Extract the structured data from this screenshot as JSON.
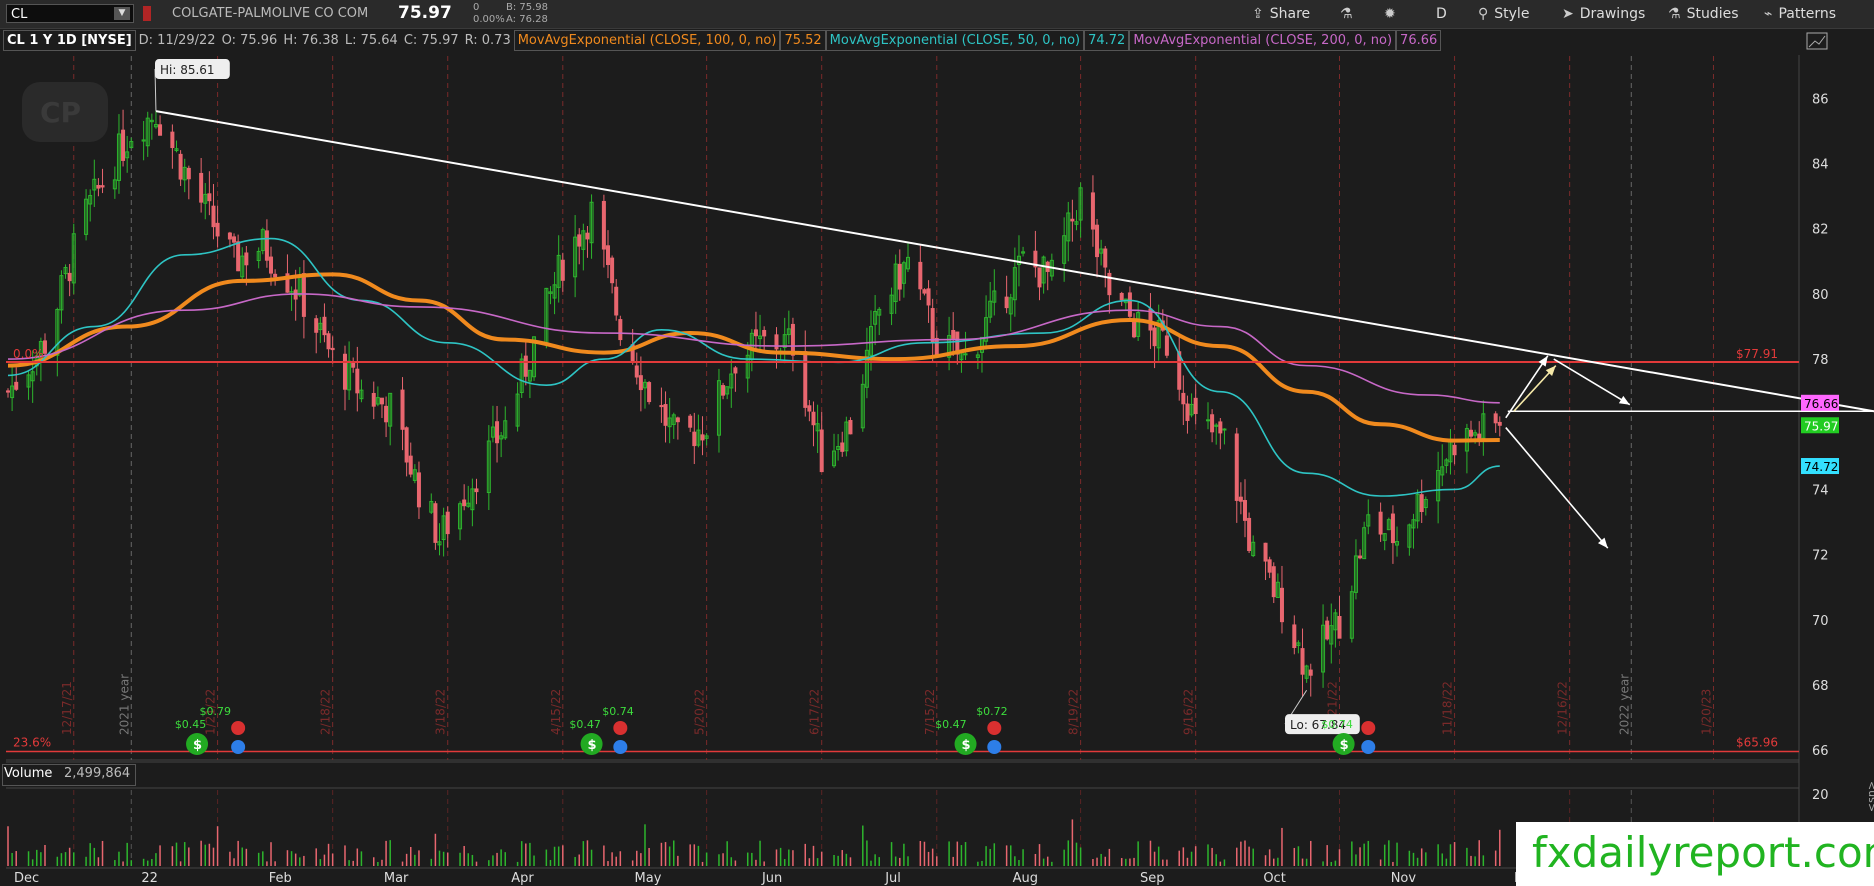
{
  "header": {
    "symbol": "CL",
    "company": "COLGATE-PALMOLIVE CO COM",
    "last": "75.97",
    "change": "0",
    "change_pct": "0.00%",
    "bid": "B: 75.98",
    "ask": "A: 76.28"
  },
  "toolbar": {
    "share": "Share",
    "period": "D",
    "style": "Style",
    "drawings": "Drawings",
    "studies": "Studies",
    "patterns": "Patterns"
  },
  "study_bar": {
    "title": "CL 1 Y 1D [NYSE]",
    "date": "D: 11/29/22",
    "open": "O: 75.96",
    "high": "H: 76.38",
    "low": "L: 75.64",
    "close": "C: 75.97",
    "range": "R: 0.73",
    "ema100_label": "MovAvgExponential (CLOSE, 100, 0, no)",
    "ema100_value": "75.52",
    "ema50_label": "MovAvgExponential (CLOSE, 50, 0, no)",
    "ema50_value": "74.72",
    "ema200_label": "MovAvgExponential (CLOSE, 200, 0, no)",
    "ema200_value": "76.66"
  },
  "volume": {
    "label": "Volume",
    "value": "2,499,864",
    "axis_tick": "20"
  },
  "watermark": "fxdailyreport.com",
  "colors": {
    "up": "#2db52d",
    "down": "#e8666f",
    "ema100": "#f08a1e",
    "ema50": "#2ec4c4",
    "ema200": "#c768c7",
    "hline": "#e23a3a"
  },
  "chart_data": {
    "type": "candlestick",
    "title": "CL 1 Y 1D [NYSE]",
    "x_months": [
      "Dec",
      "22",
      "Feb",
      "Mar",
      "Apr",
      "May",
      "Jun",
      "Jul",
      "Aug",
      "Sep",
      "Oct",
      "Nov",
      "D"
    ],
    "y_ticks": [
      66,
      68,
      70,
      72,
      74,
      76,
      78,
      80,
      82,
      84,
      86
    ],
    "ylim": [
      65.7,
      87.3
    ],
    "vertical_date_labels": [
      "12/17/21",
      "2021 year",
      "1/21/22",
      "2/18/22",
      "3/18/22",
      "4/15/22",
      "5/20/22",
      "6/17/22",
      "7/15/22",
      "8/19/22",
      "9/16/22",
      "10/21/22",
      "11/18/22",
      "12/16/22",
      "2022 year",
      "1/20/23"
    ],
    "close_path": [
      [
        "2021-12-01",
        77.0
      ],
      [
        "2021-12-10",
        78.5
      ],
      [
        "2021-12-20",
        82.5
      ],
      [
        "2021-12-31",
        85.0
      ],
      [
        "2022-01-06",
        85.6
      ],
      [
        "2022-01-14",
        83.5
      ],
      [
        "2022-01-25",
        81.0
      ],
      [
        "2022-02-01",
        81.5
      ],
      [
        "2022-02-10",
        80.0
      ],
      [
        "2022-02-18",
        78.0
      ],
      [
        "2022-02-25",
        77.0
      ],
      [
        "2022-03-04",
        76.5
      ],
      [
        "2022-03-11",
        74.0
      ],
      [
        "2022-03-16",
        72.5
      ],
      [
        "2022-03-25",
        74.5
      ],
      [
        "2022-04-01",
        76.0
      ],
      [
        "2022-04-08",
        78.5
      ],
      [
        "2022-04-15",
        81.0
      ],
      [
        "2022-04-22",
        82.5
      ],
      [
        "2022-04-29",
        79.0
      ],
      [
        "2022-05-06",
        77.0
      ],
      [
        "2022-05-13",
        75.5
      ],
      [
        "2022-05-20",
        76.0
      ],
      [
        "2022-05-27",
        78.0
      ],
      [
        "2022-06-03",
        78.5
      ],
      [
        "2022-06-10",
        78.5
      ],
      [
        "2022-06-17",
        75.0
      ],
      [
        "2022-06-24",
        76.0
      ],
      [
        "2022-07-01",
        79.5
      ],
      [
        "2022-07-08",
        81.0
      ],
      [
        "2022-07-15",
        78.5
      ],
      [
        "2022-07-22",
        78.0
      ],
      [
        "2022-07-29",
        79.5
      ],
      [
        "2022-08-05",
        81.0
      ],
      [
        "2022-08-12",
        80.5
      ],
      [
        "2022-08-19",
        83.0
      ],
      [
        "2022-08-26",
        80.0
      ],
      [
        "2022-09-02",
        79.0
      ],
      [
        "2022-09-09",
        78.5
      ],
      [
        "2022-09-16",
        76.0
      ],
      [
        "2022-09-23",
        75.5
      ],
      [
        "2022-09-30",
        72.0
      ],
      [
        "2022-10-07",
        70.5
      ],
      [
        "2022-10-13",
        68.5
      ],
      [
        "2022-10-21",
        70.0
      ],
      [
        "2022-10-28",
        73.0
      ],
      [
        "2022-11-04",
        72.5
      ],
      [
        "2022-11-11",
        74.0
      ],
      [
        "2022-11-18",
        75.5
      ],
      [
        "2022-11-29",
        75.97
      ]
    ],
    "series": [
      {
        "name": "MovAvgExponential (CLOSE, 100, 0, no)",
        "last": 75.52,
        "values": [
          [
            0,
            77.8
          ],
          [
            20,
            79.0
          ],
          [
            40,
            80.4
          ],
          [
            55,
            80.6
          ],
          [
            70,
            79.8
          ],
          [
            85,
            78.6
          ],
          [
            100,
            78.2
          ],
          [
            115,
            78.8
          ],
          [
            130,
            78.2
          ],
          [
            150,
            78.0
          ],
          [
            170,
            78.4
          ],
          [
            190,
            79.2
          ],
          [
            205,
            78.4
          ],
          [
            220,
            77.0
          ],
          [
            232,
            76.0
          ],
          [
            245,
            75.5
          ],
          [
            252,
            75.52
          ]
        ]
      },
      {
        "name": "MovAvgExponential (CLOSE, 50, 0, no)",
        "last": 74.72,
        "values": [
          [
            0,
            77.5
          ],
          [
            15,
            79.0
          ],
          [
            30,
            81.2
          ],
          [
            45,
            81.7
          ],
          [
            60,
            79.8
          ],
          [
            75,
            78.5
          ],
          [
            90,
            77.2
          ],
          [
            100,
            78.0
          ],
          [
            110,
            78.9
          ],
          [
            125,
            78.0
          ],
          [
            140,
            77.9
          ],
          [
            155,
            78.5
          ],
          [
            175,
            78.8
          ],
          [
            190,
            79.8
          ],
          [
            205,
            77.0
          ],
          [
            220,
            74.5
          ],
          [
            232,
            73.8
          ],
          [
            245,
            74.0
          ],
          [
            252,
            74.72
          ]
        ]
      },
      {
        "name": "MovAvgExponential (CLOSE, 200, 0, no)",
        "last": 76.66,
        "values": [
          [
            0,
            78.0
          ],
          [
            30,
            79.5
          ],
          [
            50,
            80.0
          ],
          [
            70,
            79.6
          ],
          [
            100,
            78.8
          ],
          [
            130,
            78.4
          ],
          [
            160,
            78.6
          ],
          [
            190,
            79.5
          ],
          [
            205,
            79.0
          ],
          [
            220,
            77.8
          ],
          [
            240,
            76.9
          ],
          [
            252,
            76.66
          ]
        ]
      }
    ],
    "hi_label": "Hi: 85.61",
    "lo_label": "Lo: 67.84",
    "hline_label": "$77.91",
    "fib_top": "0.0%",
    "fib_bottom": "23.6%",
    "fib_bottom_price": "$65.96",
    "price_tags": [
      "76.66",
      "75.97",
      "74.72"
    ],
    "dividends": [
      "$0.45",
      "$0.79",
      "$0.47",
      "$0.74",
      "$0.47",
      "$0.72",
      "$0.74"
    ]
  }
}
